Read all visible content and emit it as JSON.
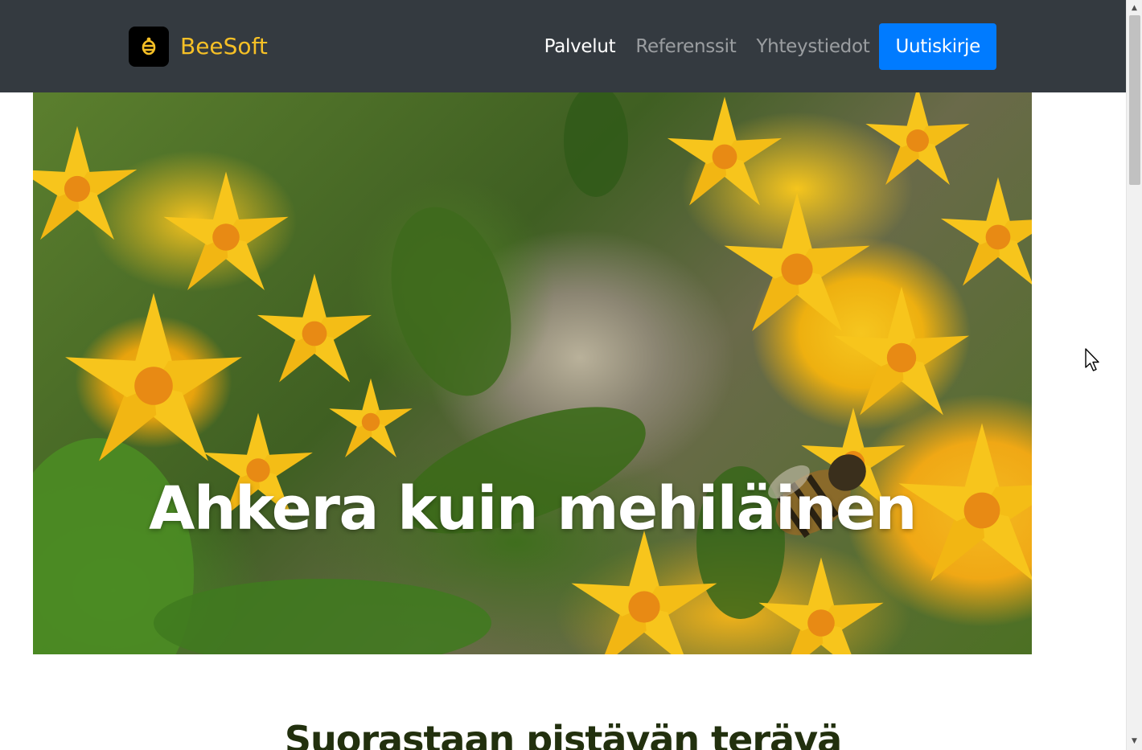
{
  "navbar": {
    "brand_name": "BeeSoft",
    "brand_logo_icon": "bee-icon",
    "links": [
      {
        "label": "Palvelut",
        "active": true
      },
      {
        "label": "Referenssit",
        "active": false
      },
      {
        "label": "Yhteystiedot",
        "active": false
      }
    ],
    "cta_label": "Uutiskirje"
  },
  "hero": {
    "title": "Ahkera kuin mehiläinen",
    "image_icon": "bee-on-yellow-flowers-photo"
  },
  "section": {
    "title": "Suorastaan pistävän terävä"
  },
  "colors": {
    "navbar_bg": "#343a40",
    "brand_color": "#f6c026",
    "cta_bg": "#007bff",
    "section_title_color": "#22300e"
  }
}
